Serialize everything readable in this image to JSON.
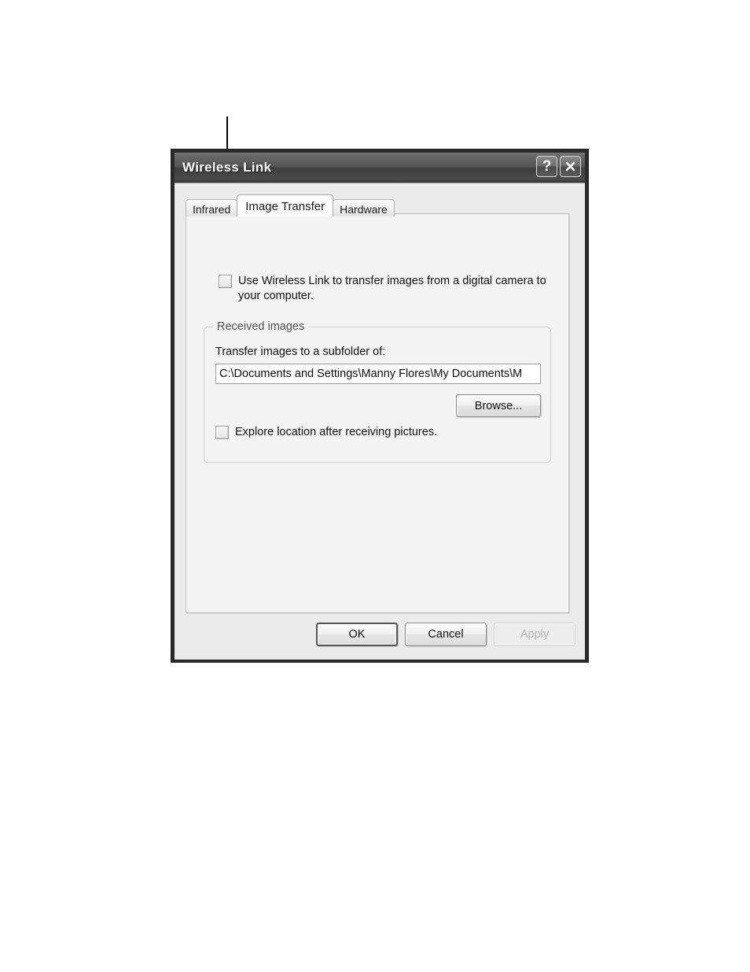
{
  "callout": {
    "name": "leader-line"
  },
  "dialog": {
    "title": "Wireless Link",
    "titlebar": {
      "help_label": "?",
      "close_label": "✕"
    },
    "tabs": [
      {
        "label": "Infrared",
        "active": false
      },
      {
        "label": "Image Transfer",
        "active": true
      },
      {
        "label": "Hardware",
        "active": false
      }
    ],
    "image_transfer": {
      "use_wireless_link_checkbox": {
        "label": "Use Wireless Link to transfer images from a digital camera to your computer.",
        "checked": false
      },
      "group": {
        "legend": "Received images",
        "transfer_label": "Transfer images to a subfolder of:",
        "path_value": "C:\\Documents and Settings\\Manny Flores\\My Documents\\M",
        "browse_label": "Browse...",
        "explore_checkbox": {
          "label": "Explore location after receiving pictures.",
          "checked": false
        }
      }
    },
    "buttons": {
      "ok": "OK",
      "cancel": "Cancel",
      "apply": "Apply"
    },
    "colors": {
      "titlebar_dark": "#3e3e3e",
      "titlebar_light": "#7a7a7a",
      "dialog_face": "#ebebeb",
      "panel_face": "#f4f4f4",
      "border_dark": "#2b2b2b",
      "disabled_text": "#b3b3b3"
    }
  }
}
